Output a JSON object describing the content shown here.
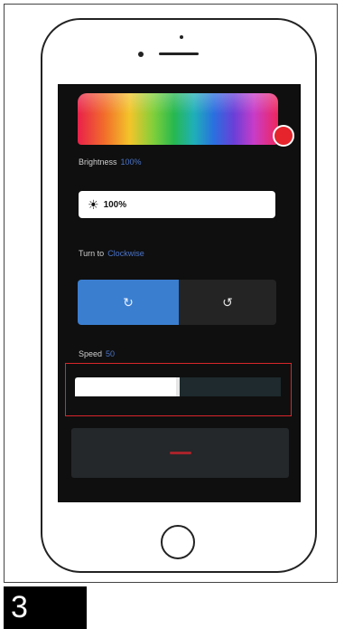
{
  "brightness": {
    "label": "Brightness",
    "value_text": "100%",
    "box_value": "100%",
    "icon": "sun-icon"
  },
  "turn_to": {
    "label": "Turn to",
    "value_text": "Clockwise",
    "options": [
      {
        "icon": "rotate-clockwise-icon",
        "glyph": "↻",
        "selected": true
      },
      {
        "icon": "rotate-counterclockwise-icon",
        "glyph": "↺",
        "selected": false
      }
    ]
  },
  "speed": {
    "label": "Speed",
    "value_text": "50",
    "level": 0.5
  },
  "step_number": "3",
  "colors": {
    "accent": "#3a7ed0",
    "highlight": "#d9262c",
    "handle": "#e5242c"
  }
}
